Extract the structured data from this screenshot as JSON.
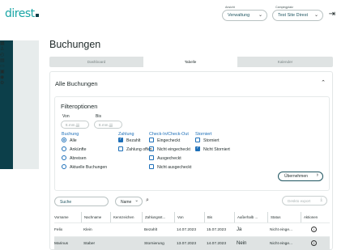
{
  "header": {
    "logo": "direst",
    "ansicht_caption": "Ansicht",
    "ansicht_value": "Verwaltung",
    "campingplatz_caption": "Campingplatz",
    "campingplatz_value": "Test Site Direst"
  },
  "page_title": "Buchungen",
  "tabs": [
    "Dashboard",
    "Tabelle",
    "Kalender"
  ],
  "panel": {
    "title": "Alle Buchungen"
  },
  "filters": {
    "title": "Filteroptionen",
    "von_label": "Von",
    "bis_label": "Bis",
    "von_placeholder": "tt.mm.jjjj",
    "bis_placeholder": "tt.mm.jjjj",
    "buchung": {
      "label": "Buchung",
      "options": [
        "Alle",
        "Ankünfte",
        "Abreisen",
        "Aktuelle Buchungen"
      ],
      "selected": "Alle"
    },
    "zahlung": {
      "label": "Zahlung",
      "options": [
        "Bezahlt",
        "Zahlung offen"
      ],
      "checked": [
        true,
        false
      ]
    },
    "checkin": {
      "label": "Check-In/Check-Out",
      "options": [
        "Eingecheckt",
        "Nicht eingecheckt",
        "Ausgecheckt",
        "Nicht ausgecheckt"
      ],
      "checked": [
        false,
        true,
        false,
        false
      ]
    },
    "storniert": {
      "label": "Storniert",
      "options": [
        "Storniert",
        "Nicht Storniert"
      ],
      "checked": [
        false,
        true
      ]
    },
    "apply_label": "Übernehmen"
  },
  "toolbar": {
    "search_placeholder": "Suche",
    "name_select": "Name",
    "export_label": "Deskto export"
  },
  "table": {
    "columns": [
      "Vorname",
      "Nachname",
      "Kennzeichen",
      "Zahlungsst...",
      "Von",
      "Bis",
      "Außerhalb ...",
      "Status",
      "Aktionen"
    ],
    "rows": [
      [
        "Felix",
        "Klein",
        "",
        "Bezahlt",
        "14.07.2023",
        "15.07.2023",
        "Ja",
        "Nicht einge...",
        "i"
      ],
      [
        "Marinus",
        "Staber",
        "",
        "Stornierung",
        "13.07.2023",
        "14.07.2023",
        "Nein",
        "Nicht einge...",
        "i"
      ]
    ]
  },
  "colors": {
    "brand_teal": "#1aa6a6",
    "sidebar_dark": "#0c3f4a",
    "link_blue": "#1d6fb8"
  }
}
